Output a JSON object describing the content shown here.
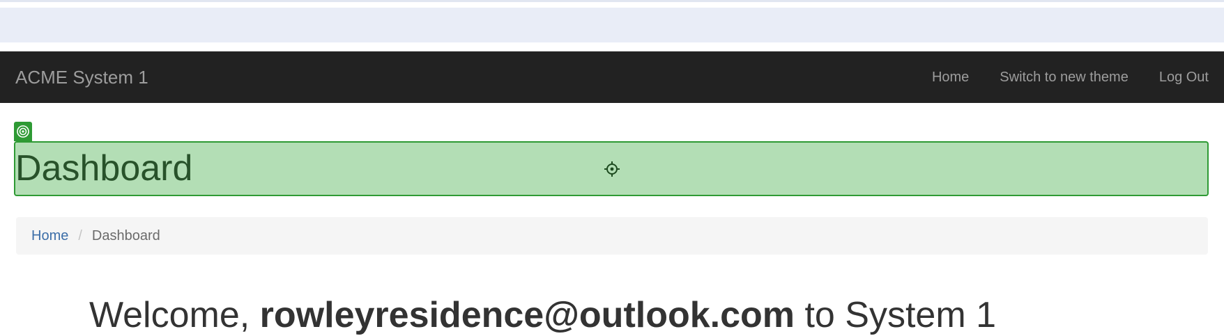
{
  "navbar": {
    "brand": "ACME System 1",
    "links": [
      {
        "label": "Home"
      },
      {
        "label": "Switch to new theme"
      },
      {
        "label": "Log Out"
      }
    ],
    "background": "#222222"
  },
  "main": {
    "title": "Dashboard",
    "breadcrumb": {
      "home": "Home",
      "separator": "/",
      "current": "Dashboard"
    },
    "welcome": {
      "prefix": "Welcome,",
      "user": "rowleyresidence@outlook.com",
      "suffix": "to System 1"
    }
  },
  "overlay": {
    "highlight_color": "#b3deb5",
    "border_color": "#2e9a34",
    "tag_icon": "target-icon",
    "cursor_icon": "crosshair-icon"
  }
}
